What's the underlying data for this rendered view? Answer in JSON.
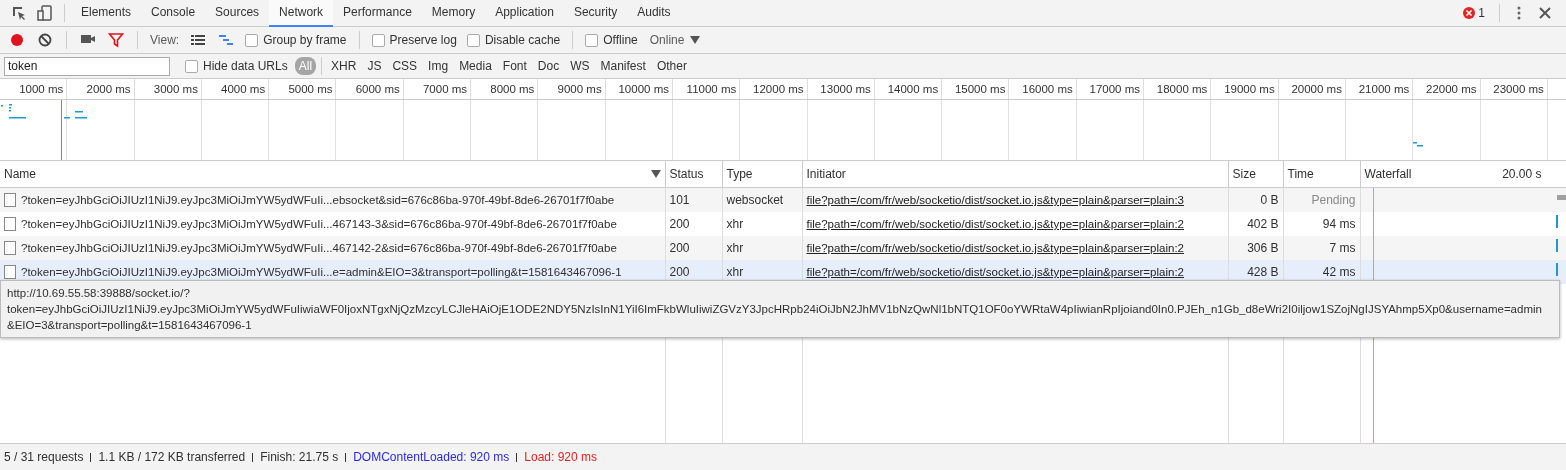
{
  "tabs": [
    {
      "label": "Elements",
      "selected": false
    },
    {
      "label": "Console",
      "selected": false
    },
    {
      "label": "Sources",
      "selected": false
    },
    {
      "label": "Network",
      "selected": true
    },
    {
      "label": "Performance",
      "selected": false
    },
    {
      "label": "Memory",
      "selected": false
    },
    {
      "label": "Application",
      "selected": false
    },
    {
      "label": "Security",
      "selected": false
    },
    {
      "label": "Audits",
      "selected": false
    }
  ],
  "error_count": "1",
  "toolbar": {
    "recording": true,
    "filter_active": true,
    "view_label": "View:",
    "large_rows": false,
    "overview": true,
    "checkboxes": [
      {
        "label": "Group by frame",
        "checked": false
      },
      {
        "label": "Preserve log",
        "checked": false
      },
      {
        "label": "Disable cache",
        "checked": false
      },
      {
        "label": "Offline",
        "checked": false
      }
    ],
    "throttling": "Online"
  },
  "filter_bar": {
    "value": "token",
    "hide_data_urls": {
      "label": "Hide data URLs",
      "checked": false
    },
    "types": [
      {
        "label": "All",
        "selected": true
      },
      {
        "label": "XHR",
        "selected": false
      },
      {
        "label": "JS",
        "selected": false
      },
      {
        "label": "CSS",
        "selected": false
      },
      {
        "label": "Img",
        "selected": false
      },
      {
        "label": "Media",
        "selected": false
      },
      {
        "label": "Font",
        "selected": false
      },
      {
        "label": "Doc",
        "selected": false
      },
      {
        "label": "WS",
        "selected": false
      },
      {
        "label": "Manifest",
        "selected": false
      },
      {
        "label": "Other",
        "selected": false
      }
    ]
  },
  "overview_ticks": [
    "1000 ms",
    "2000 ms",
    "3000 ms",
    "4000 ms",
    "5000 ms",
    "6000 ms",
    "7000 ms",
    "8000 ms",
    "9000 ms",
    "10000 ms",
    "11000 ms",
    "12000 ms",
    "13000 ms",
    "14000 ms",
    "15000 ms",
    "16000 ms",
    "17000 ms",
    "18000 ms",
    "19000 ms",
    "20000 ms",
    "21000 ms",
    "22000 ms",
    "23000 ms"
  ],
  "table": {
    "columns": [
      "Name",
      "Status",
      "Type",
      "Initiator",
      "Size",
      "Time",
      "Waterfall"
    ],
    "waterfall_scale": "20.00 s",
    "rows": [
      {
        "name": "?token=eyJhbGciOiJIUzI1NiJ9.eyJpc3MiOiJmYW5ydWFuIi...ebsocket&sid=676c86ba-970f-49bf-8de6-26701f7f0abe",
        "status": "101",
        "type": "websocket",
        "initiator": "file?path=/com/fr/web/socketio/dist/socket.io.js&type=plain&parser=plain:3",
        "size": "0 B",
        "time": "Pending",
        "pending": true,
        "hovered": false
      },
      {
        "name": "?token=eyJhbGciOiJIUzI1NiJ9.eyJpc3MiOiJmYW5ydWFuIi...467143-3&sid=676c86ba-970f-49bf-8de6-26701f7f0abe",
        "status": "200",
        "type": "xhr",
        "initiator": "file?path=/com/fr/web/socketio/dist/socket.io.js&type=plain&parser=plain:2",
        "size": "402 B",
        "time": "94 ms",
        "pending": false,
        "hovered": false
      },
      {
        "name": "?token=eyJhbGciOiJIUzI1NiJ9.eyJpc3MiOiJmYW5ydWFuIi...467142-2&sid=676c86ba-970f-49bf-8de6-26701f7f0abe",
        "status": "200",
        "type": "xhr",
        "initiator": "file?path=/com/fr/web/socketio/dist/socket.io.js&type=plain&parser=plain:2",
        "size": "306 B",
        "time": "7 ms",
        "pending": false,
        "hovered": false
      },
      {
        "name": "?token=eyJhbGciOiJIUzI1NiJ9.eyJpc3MiOiJmYW5ydWFuIi...e=admin&EIO=3&transport=polling&t=1581643467096-1",
        "status": "200",
        "type": "xhr",
        "initiator": "file?path=/com/fr/web/socketio/dist/socket.io.js&type=plain&parser=plain:2",
        "size": "428 B",
        "time": "42 ms",
        "pending": false,
        "hovered": true
      }
    ]
  },
  "tooltip": {
    "lines": [
      "http://10.69.55.58:39888/socket.io/?",
      "token=eyJhbGciOiJIUzI1NiJ9.eyJpc3MiOiJmYW5ydWFuIiwiaWF0IjoxNTgxNjQzMzcyLCJleHAiOjE1ODE2NDY5NzIsInN1YiI6ImFkbWluIiwiZGVzY3JpcHRpb24iOiJbN2JhMV1bNzQwNl1bNTQ1OF0oYWRtaW4pIiwianRpIjoiand0In0.PJEh_n1Gb_d8eWri2I0iljow1SZojNgIJSYAhmp5Xp0&username=admin",
      "&EIO=3&transport=polling&t=1581643467096-1"
    ]
  },
  "status_bar": [
    {
      "text": "5 / 31 requests",
      "kind": "plain"
    },
    {
      "text": "1.1 KB / 172 KB transferred",
      "kind": "plain"
    },
    {
      "text": "Finish: 21.75 s",
      "kind": "plain"
    },
    {
      "text": "DOMContentLoaded: 920 ms",
      "kind": "dom"
    },
    {
      "text": "Load: 920 ms",
      "kind": "load"
    }
  ]
}
